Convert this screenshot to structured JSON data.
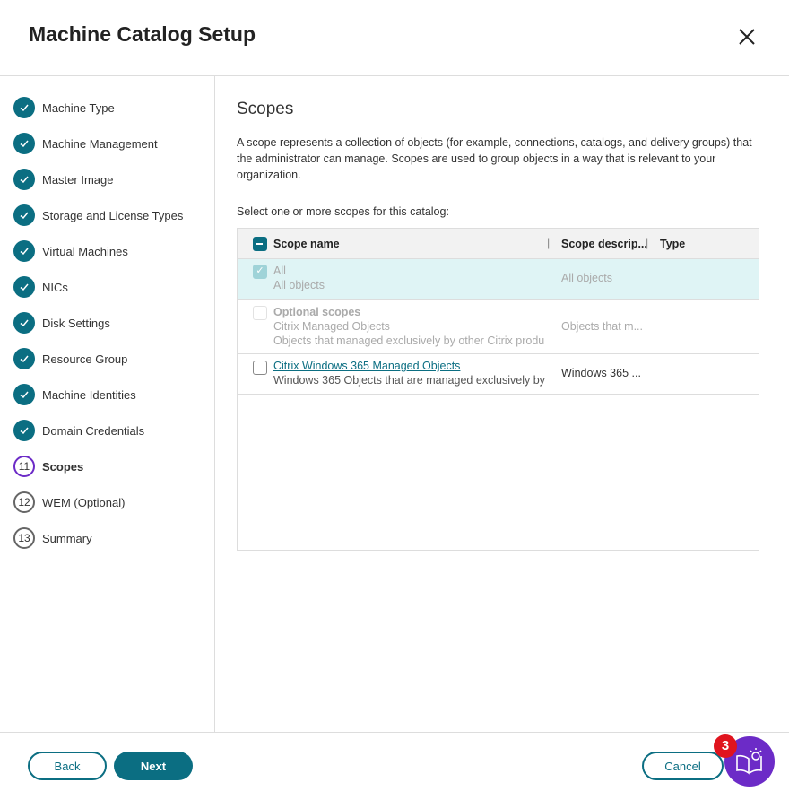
{
  "header": {
    "title": "Machine Catalog Setup"
  },
  "steps": [
    {
      "label": "Machine Type",
      "state": "done"
    },
    {
      "label": "Machine Management",
      "state": "done"
    },
    {
      "label": "Master Image",
      "state": "done"
    },
    {
      "label": "Storage and License Types",
      "state": "done"
    },
    {
      "label": "Virtual Machines",
      "state": "done"
    },
    {
      "label": "NICs",
      "state": "done"
    },
    {
      "label": "Disk Settings",
      "state": "done"
    },
    {
      "label": "Resource Group",
      "state": "done"
    },
    {
      "label": "Machine Identities",
      "state": "done"
    },
    {
      "label": "Domain Credentials",
      "state": "done"
    },
    {
      "label": "Scopes",
      "state": "current",
      "num": "11"
    },
    {
      "label": "WEM (Optional)",
      "state": "todo",
      "num": "12"
    },
    {
      "label": "Summary",
      "state": "todo",
      "num": "13"
    }
  ],
  "main": {
    "title": "Scopes",
    "description": "A scope represents a collection of objects (for example, connections, catalogs, and delivery groups) that the administrator can manage. Scopes are used to group objects in a way that is relevant to your organization.",
    "select_label": "Select one or more scopes for this catalog:",
    "columns": [
      "Scope name",
      "Scope descrip...",
      "Type"
    ],
    "rows": [
      {
        "name": "All",
        "sub": "All objects",
        "desc": "All objects"
      },
      {
        "group": "Optional scopes",
        "name": "Citrix Managed Objects",
        "sub": "Objects that managed exclusively by other Citrix produ",
        "desc": "Objects that m..."
      },
      {
        "name": "Citrix Windows 365 Managed Objects",
        "sub": "Windows 365 Objects that are managed exclusively by",
        "desc": "Windows 365 ..."
      }
    ]
  },
  "footer": {
    "back": "Back",
    "next": "Next",
    "cancel": "Cancel",
    "help_badge": "3"
  },
  "colors": {
    "teal": "#0b6e82",
    "purple": "#6c2bc7",
    "badge": "#e0141e",
    "selected_row": "#dff4f5"
  }
}
